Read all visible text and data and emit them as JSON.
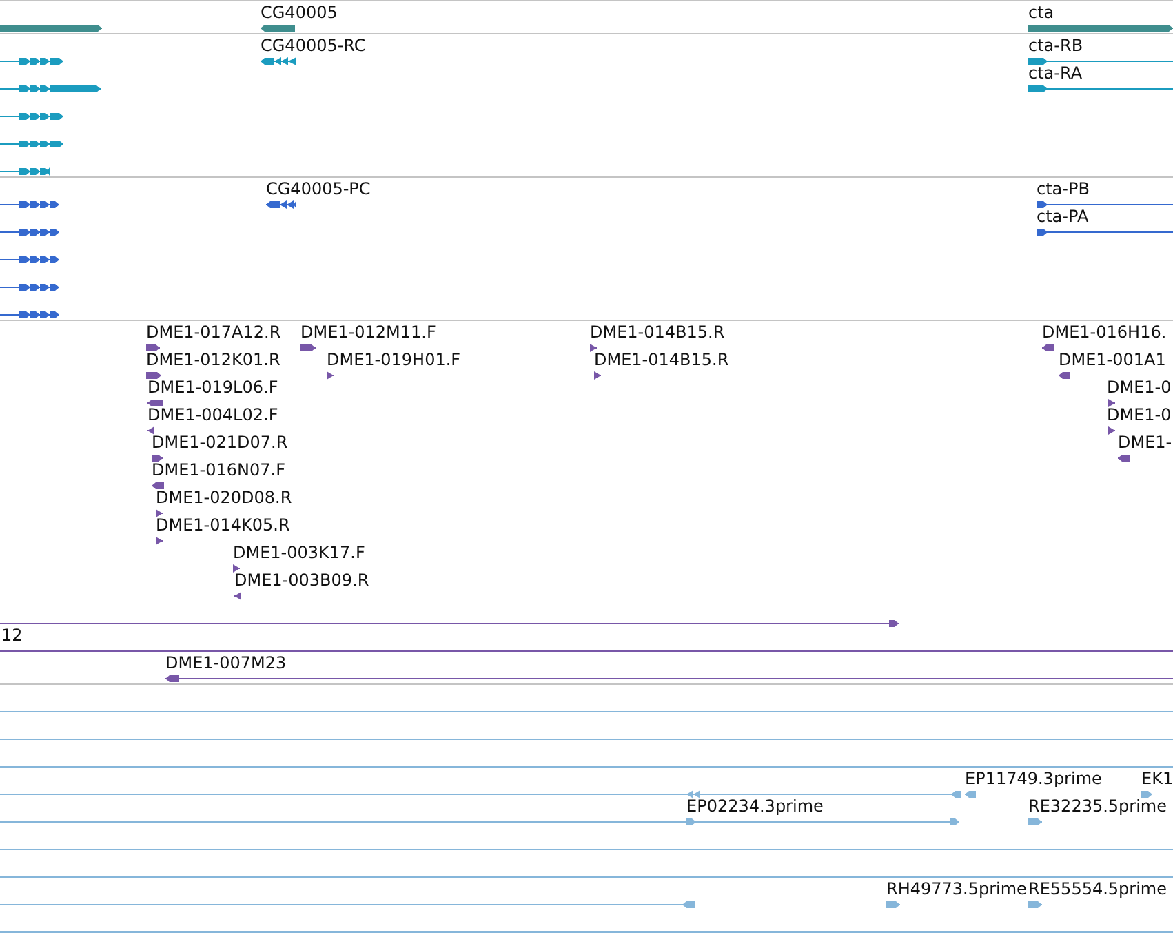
{
  "tracks": [
    {
      "kind": "gene",
      "features": [
        {
          "label": "CG40005",
          "reverse": true
        },
        {
          "label": "cta",
          "reverse": false
        }
      ]
    },
    {
      "kind": "transcript",
      "features": [
        {
          "label": "CG40005-RC",
          "reverse": true
        },
        {
          "label": "cta-RB",
          "reverse": false
        },
        {
          "label": "cta-RA",
          "reverse": false
        }
      ]
    },
    {
      "kind": "protein",
      "features": [
        {
          "label": "CG40005-PC",
          "reverse": true
        },
        {
          "label": "cta-PB",
          "reverse": false
        },
        {
          "label": "cta-PA",
          "reverse": false
        }
      ]
    },
    {
      "kind": "clone",
      "features": [
        {
          "label": "DME1-017A12.R",
          "reverse": false
        },
        {
          "label": "DME1-012K01.R",
          "reverse": false
        },
        {
          "label": "DME1-019L06.F",
          "reverse": true
        },
        {
          "label": "DME1-004L02.F",
          "reverse": true
        },
        {
          "label": "DME1-021D07.R",
          "reverse": false
        },
        {
          "label": "DME1-016N07.F",
          "reverse": true
        },
        {
          "label": "DME1-020D08.R",
          "reverse": false
        },
        {
          "label": "DME1-014K05.R",
          "reverse": false
        },
        {
          "label": "DME1-003K17.F",
          "reverse": false
        },
        {
          "label": "DME1-003B09.R",
          "reverse": true
        },
        {
          "label": "DME1-012M11.F",
          "reverse": false
        },
        {
          "label": "DME1-019H01.F",
          "reverse": false
        },
        {
          "label": "DME1-014B15.R",
          "reverse": false
        },
        {
          "label": "DME1-014B15.R",
          "reverse": false
        },
        {
          "label": "DME1-016H16.",
          "reverse": true
        },
        {
          "label": "DME1-001A1",
          "reverse": true
        },
        {
          "label": "DME1-0",
          "reverse": false
        },
        {
          "label": "DME1-0",
          "reverse": false
        },
        {
          "label": "DME1-",
          "reverse": true
        },
        {
          "label": "12"
        },
        {
          "label": "DME1-007M23",
          "reverse": true
        }
      ]
    },
    {
      "kind": "est",
      "features": [
        {
          "label": "EP11749.3prime",
          "reverse": true
        },
        {
          "label": "EK1",
          "reverse": false
        },
        {
          "label": "EP02234.3prime",
          "reverse": false
        },
        {
          "label": "RE32235.5prime",
          "reverse": false
        },
        {
          "label": "RH49773.5prime",
          "reverse": false
        },
        {
          "label": "RE55554.5prime",
          "reverse": false
        }
      ]
    }
  ]
}
